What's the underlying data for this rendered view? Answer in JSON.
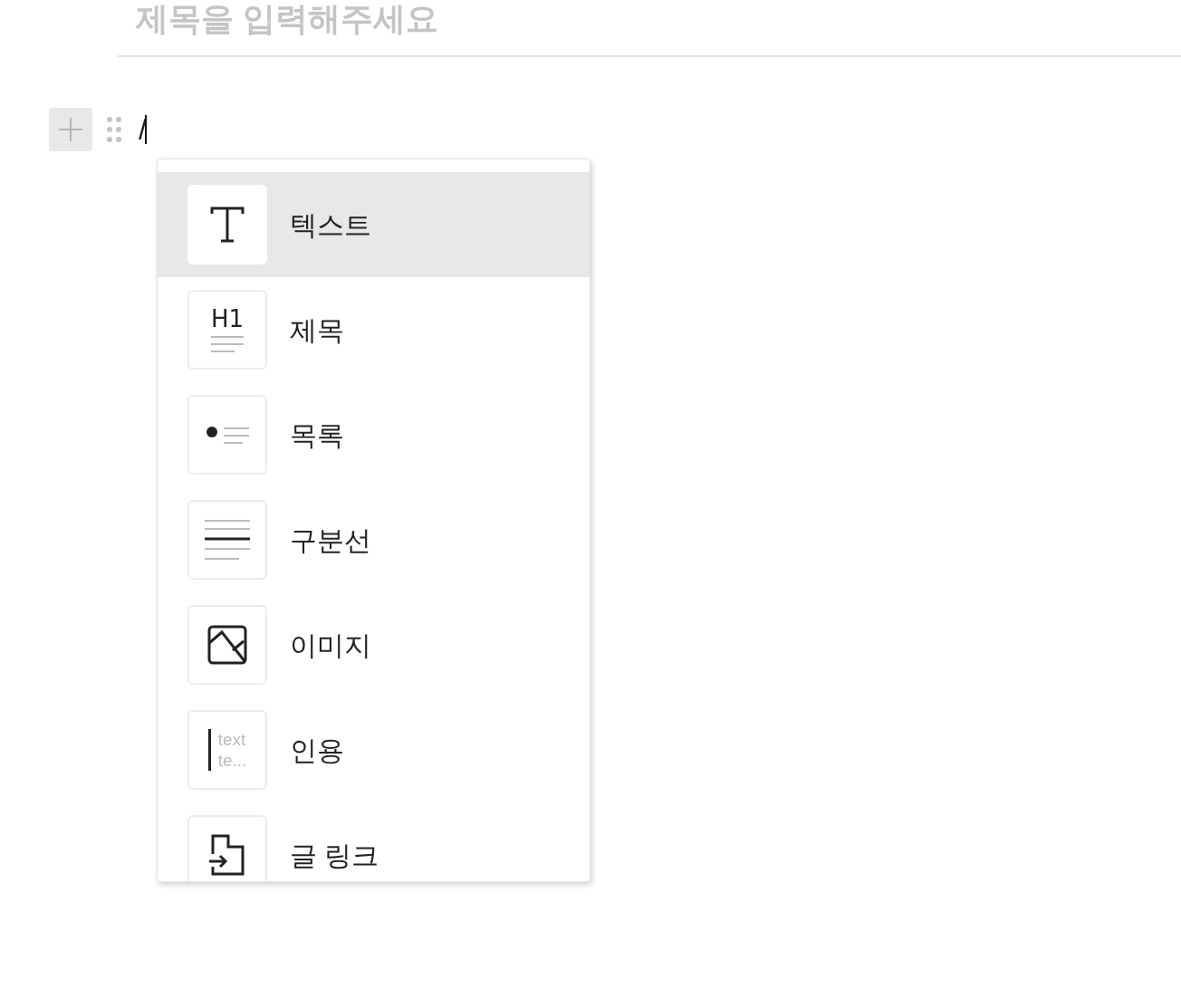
{
  "title_placeholder": "제목을 입력해주세요",
  "editor": {
    "typed": "/"
  },
  "menu": {
    "items": [
      {
        "kind": "text",
        "label": "텍스트",
        "selected": true
      },
      {
        "kind": "heading",
        "label": "제목",
        "icon_text": "H1",
        "selected": false
      },
      {
        "kind": "list",
        "label": "목록",
        "selected": false
      },
      {
        "kind": "divider",
        "label": "구분선",
        "selected": false
      },
      {
        "kind": "image",
        "label": "이미지",
        "selected": false
      },
      {
        "kind": "quote",
        "label": "인용",
        "preview": [
          "text",
          "te..."
        ],
        "selected": false
      },
      {
        "kind": "link",
        "label": "글 링크",
        "selected": false
      }
    ]
  }
}
